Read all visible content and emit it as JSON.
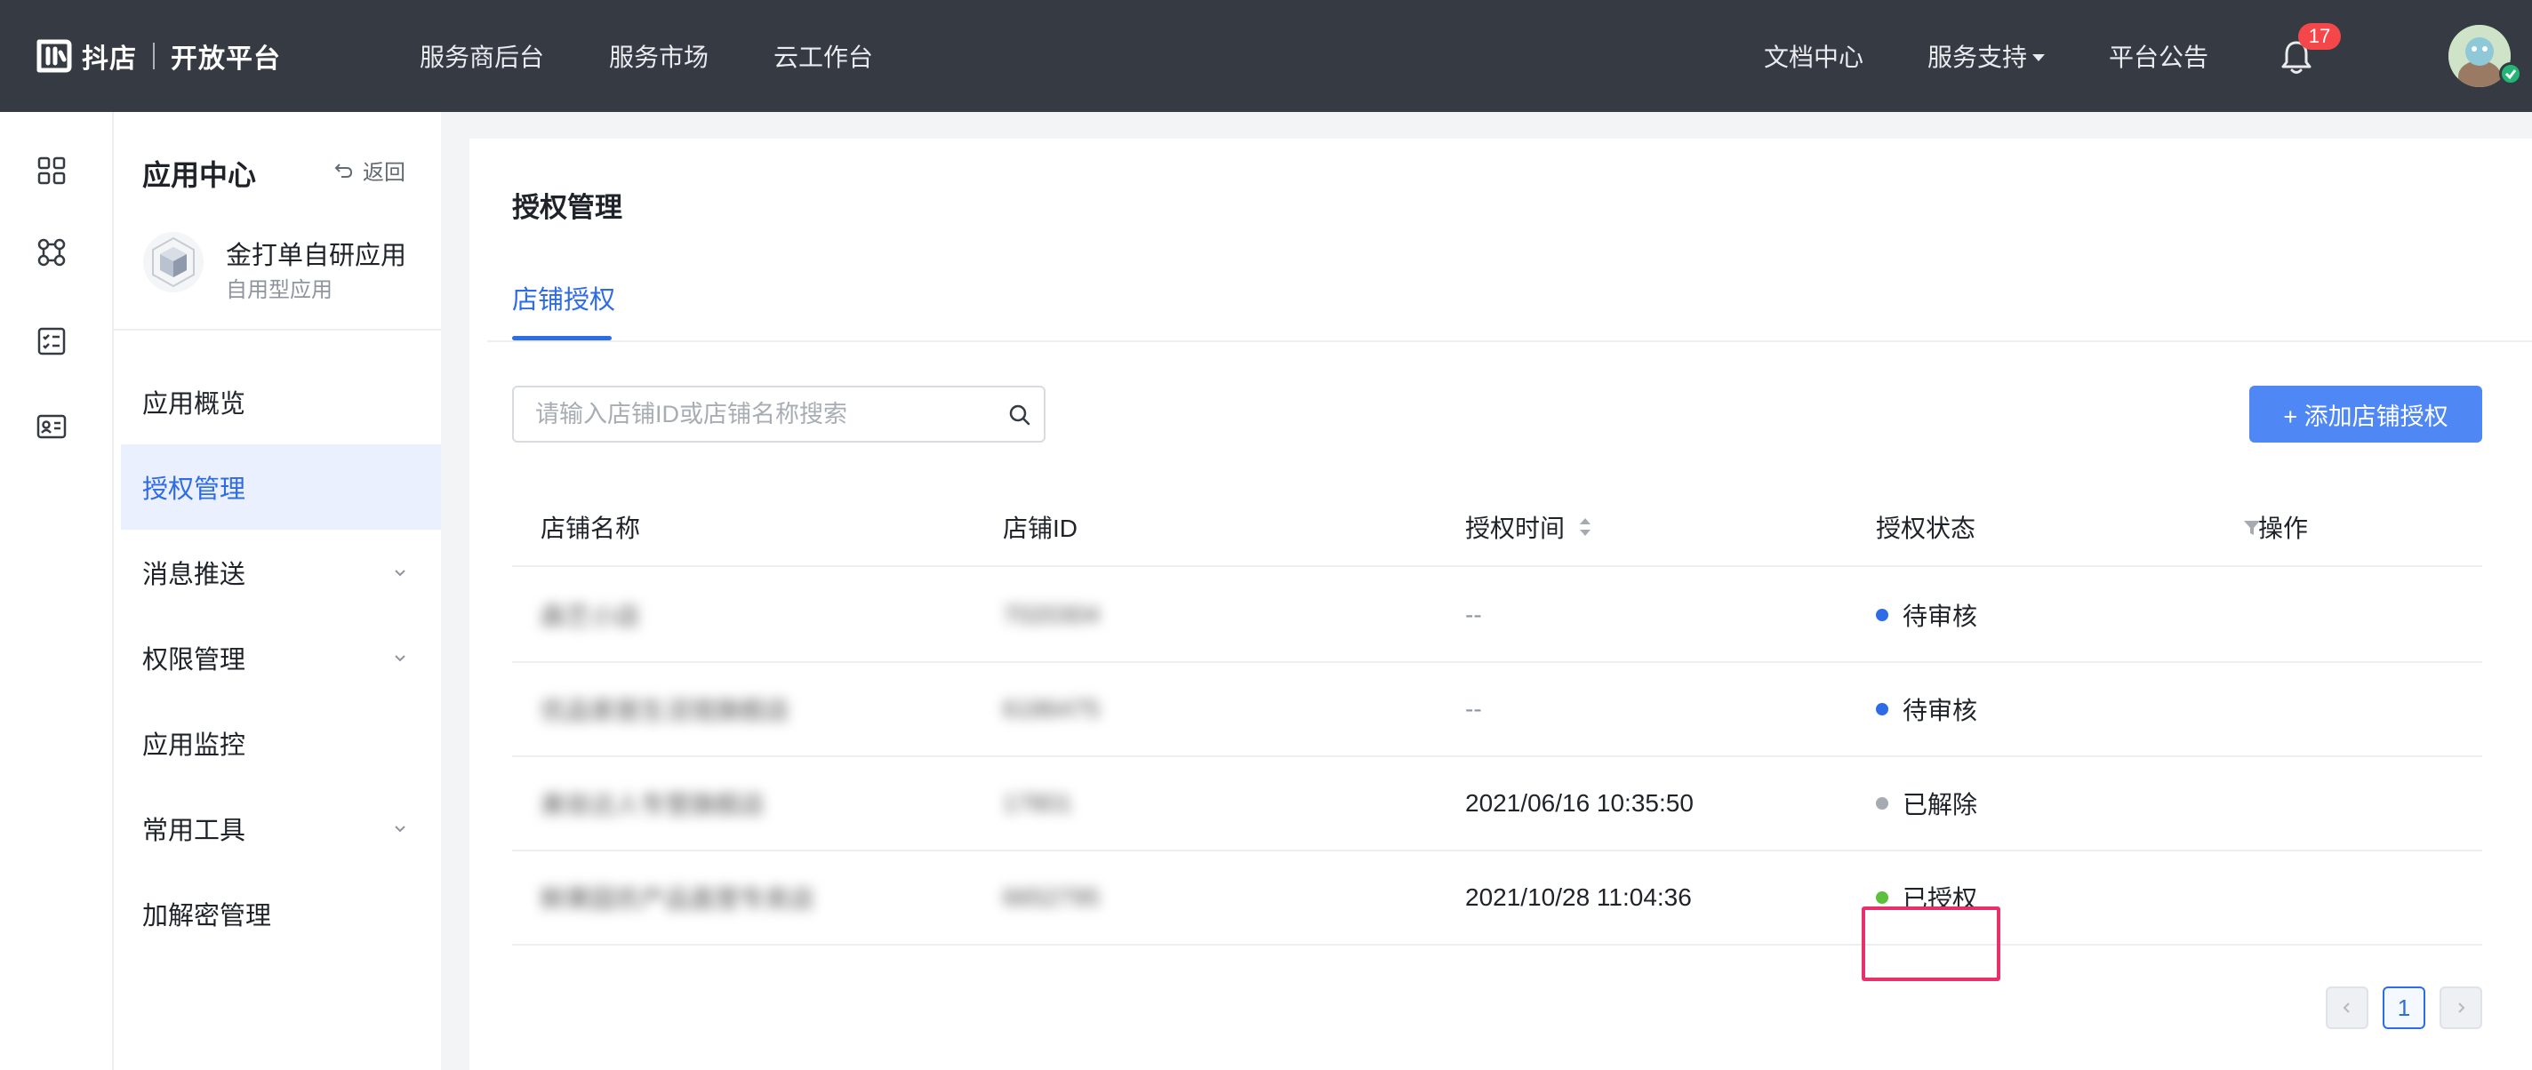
{
  "brand": {
    "name": "抖店",
    "product": "开放平台"
  },
  "top_nav": {
    "left": [
      "服务商后台",
      "服务市场",
      "云工作台"
    ],
    "right": {
      "docs": "文档中心",
      "support": "服务支持",
      "announcements": "平台公告"
    },
    "notification_count": "17"
  },
  "sidebar": {
    "title": "应用中心",
    "back_label": "返回",
    "app": {
      "name": "金打单自研应用",
      "type": "自用型应用"
    },
    "items": [
      {
        "label": "应用概览"
      },
      {
        "label": "授权管理"
      },
      {
        "label": "消息推送"
      },
      {
        "label": "权限管理"
      },
      {
        "label": "应用监控"
      },
      {
        "label": "常用工具"
      },
      {
        "label": "加解密管理"
      }
    ]
  },
  "main": {
    "title": "授权管理",
    "tab": "店铺授权",
    "search": {
      "placeholder": "请输入店铺ID或店铺名称搜索",
      "value": ""
    },
    "add_button": "+ 添加店铺授权",
    "columns": {
      "name": "店铺名称",
      "id": "店铺ID",
      "time": "授权时间",
      "status": "授权状态",
      "action": "操作"
    },
    "rows": [
      {
        "name": "森艺小店",
        "id": "7020304",
        "time": "--",
        "status": "待审核"
      },
      {
        "name": "优品家居生活馆旗舰店",
        "id": "6186475",
        "time": "--",
        "status": "待审核"
      },
      {
        "name": "美妆达人专营旗舰店",
        "id": "17801",
        "time": "2021/06/16 10:35:50",
        "status": "已解除"
      },
      {
        "name": "鲜果园农产品直营专卖店",
        "id": "6652795",
        "time": "2021/10/28 11:04:36",
        "status": "已授权"
      }
    ],
    "status_colors": {
      "待审核": "#2e6be6",
      "已解除": "#a6abb2",
      "已授权": "#5cc13a"
    },
    "pagination": {
      "current": "1"
    }
  }
}
